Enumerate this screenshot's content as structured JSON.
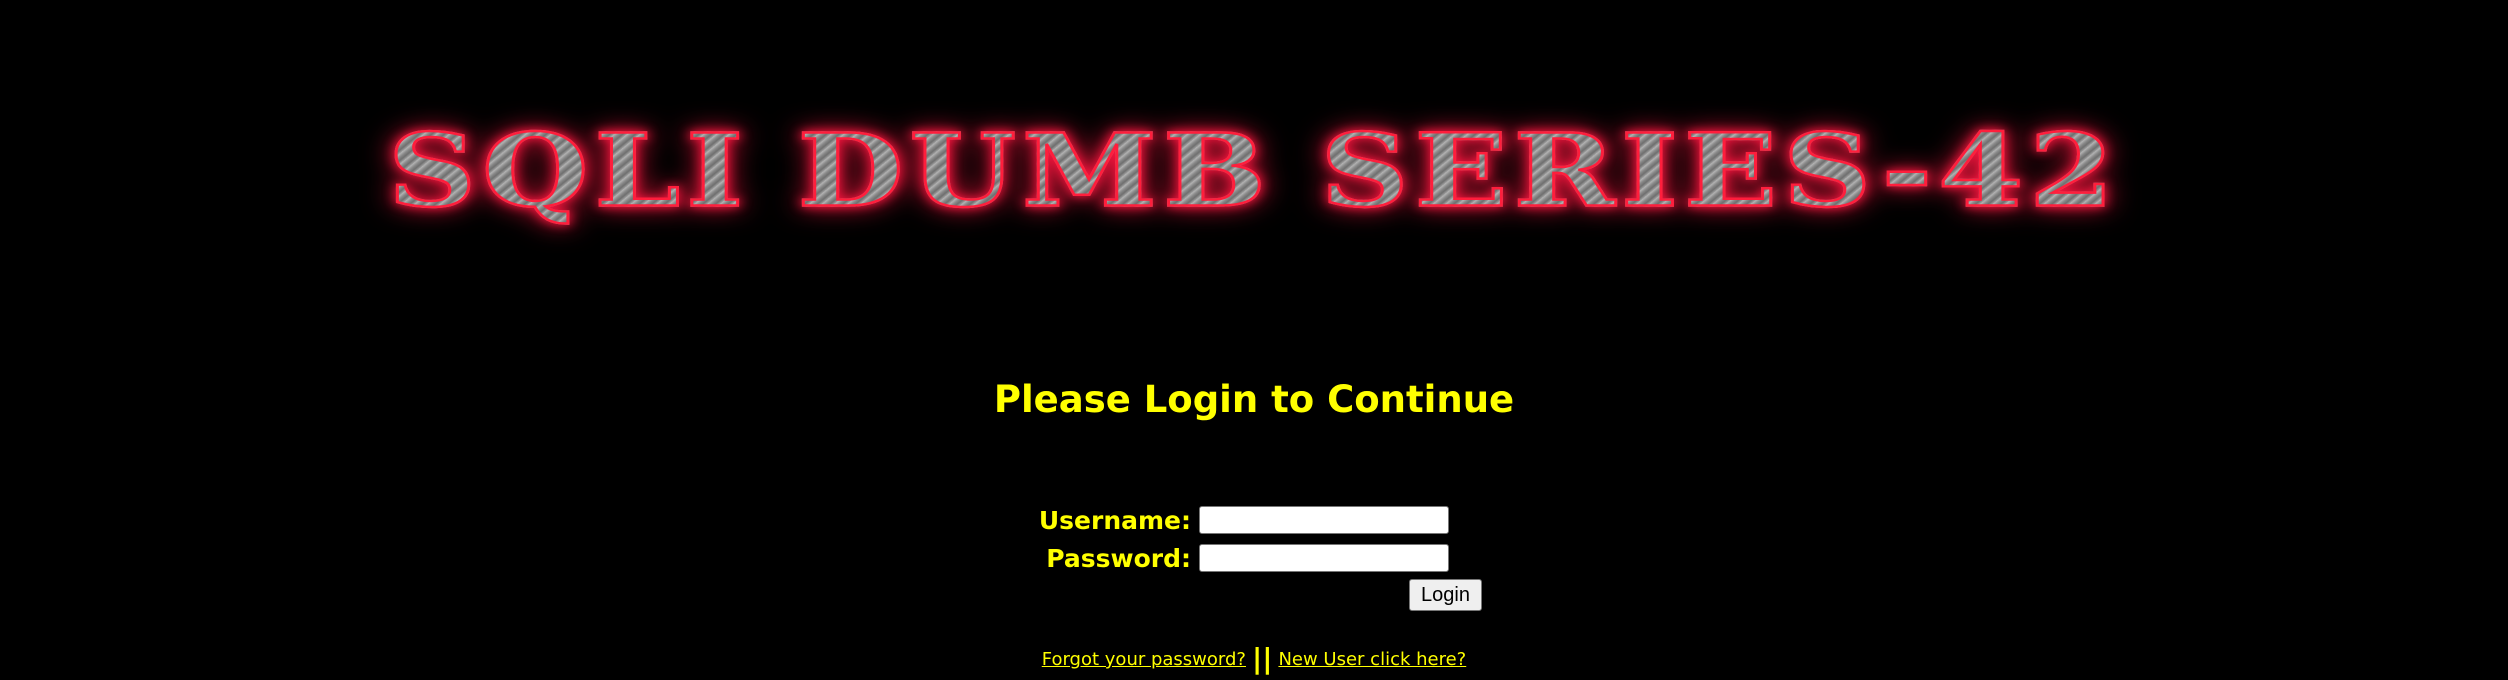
{
  "banner": {
    "title": "SQLI DUMB SERIES-42"
  },
  "login": {
    "heading": "Please Login to Continue",
    "username_label": "Username:",
    "username_value": "",
    "password_label": "Password:",
    "password_value": "",
    "submit_label": "Login"
  },
  "links": {
    "forgot_password": "Forgot your password?",
    "separator": "||",
    "new_user": "New User click here?"
  },
  "colors": {
    "background": "#000000",
    "text": "#ffff00",
    "banner_glow": "#ff1e3c",
    "banner_fill": "#9a9a9a"
  }
}
